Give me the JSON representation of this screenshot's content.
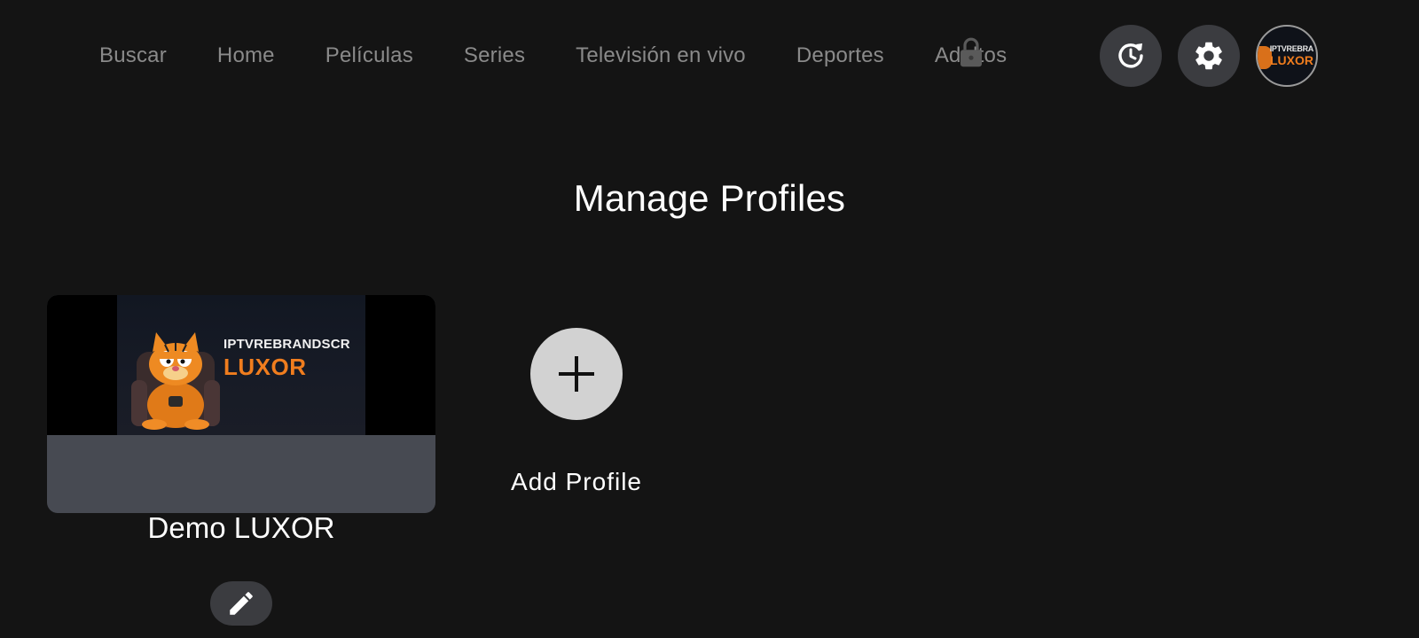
{
  "nav": {
    "items": [
      {
        "label": "Buscar"
      },
      {
        "label": "Home"
      },
      {
        "label": "Películas"
      },
      {
        "label": "Series"
      },
      {
        "label": "Televisión en vivo"
      },
      {
        "label": "Deportes"
      },
      {
        "label": "Adultos",
        "locked": true
      }
    ]
  },
  "toolbar": {
    "history_icon": "history-refresh-icon",
    "settings_icon": "gear-icon",
    "avatar": {
      "line1": "IPTVREBRA",
      "line2": "LUXOR"
    }
  },
  "page": {
    "title": "Manage Profiles"
  },
  "profiles": [
    {
      "name": "Demo LUXOR",
      "banner_line1": "IPTVREBRANDSCR",
      "banner_line2": "LUXOR",
      "edit_icon": "pencil-icon"
    }
  ],
  "add_profile": {
    "label": "Add Profile",
    "icon": "plus-icon"
  },
  "colors": {
    "background": "#141414",
    "nav_text": "#8a8a8a",
    "button_bg": "#3b3c40",
    "card_footer": "#474a52",
    "brand_orange": "#f07d1e",
    "add_button": "#d2d2d2"
  }
}
